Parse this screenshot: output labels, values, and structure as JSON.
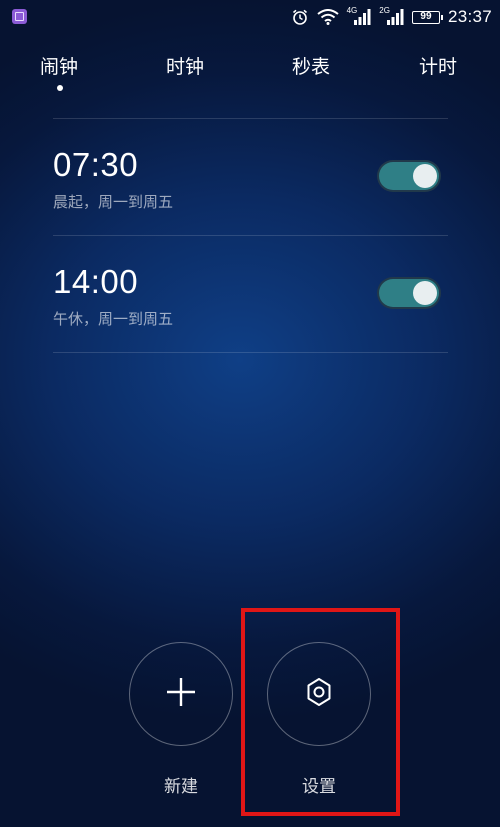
{
  "status_bar": {
    "network_a": "4G",
    "network_b": "2G",
    "battery": "99",
    "time": "23:37"
  },
  "tabs": [
    {
      "label": "闹钟",
      "selected": true
    },
    {
      "label": "时钟",
      "selected": false
    },
    {
      "label": "秒表",
      "selected": false
    },
    {
      "label": "计时",
      "selected": false
    }
  ],
  "alarms": [
    {
      "time": "07:30",
      "desc": "晨起，周一到周五",
      "enabled": true
    },
    {
      "time": "14:00",
      "desc": "午休，周一到周五",
      "enabled": true
    }
  ],
  "actions": {
    "new_label": "新建",
    "settings_label": "设置"
  },
  "colors": {
    "toggle_on": "#2f7f86",
    "highlight": "#e01616"
  }
}
